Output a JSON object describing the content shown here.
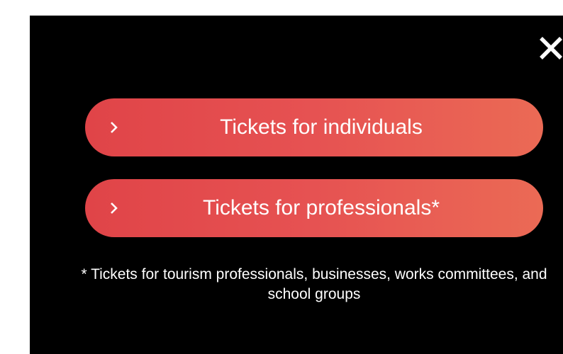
{
  "modal": {
    "close_icon": "close-icon",
    "buttons": [
      {
        "label": "Tickets for individuals",
        "icon": "chevron-right-icon"
      },
      {
        "label": "Tickets for professionals*",
        "icon": "chevron-right-icon"
      }
    ],
    "footnote": "* Tickets for tourism professionals, businesses, works committees, and school groups"
  },
  "colors": {
    "background": "#000000",
    "button_gradient_start": "#e04448",
    "button_gradient_end": "#eb6a55",
    "text": "#ffffff"
  }
}
